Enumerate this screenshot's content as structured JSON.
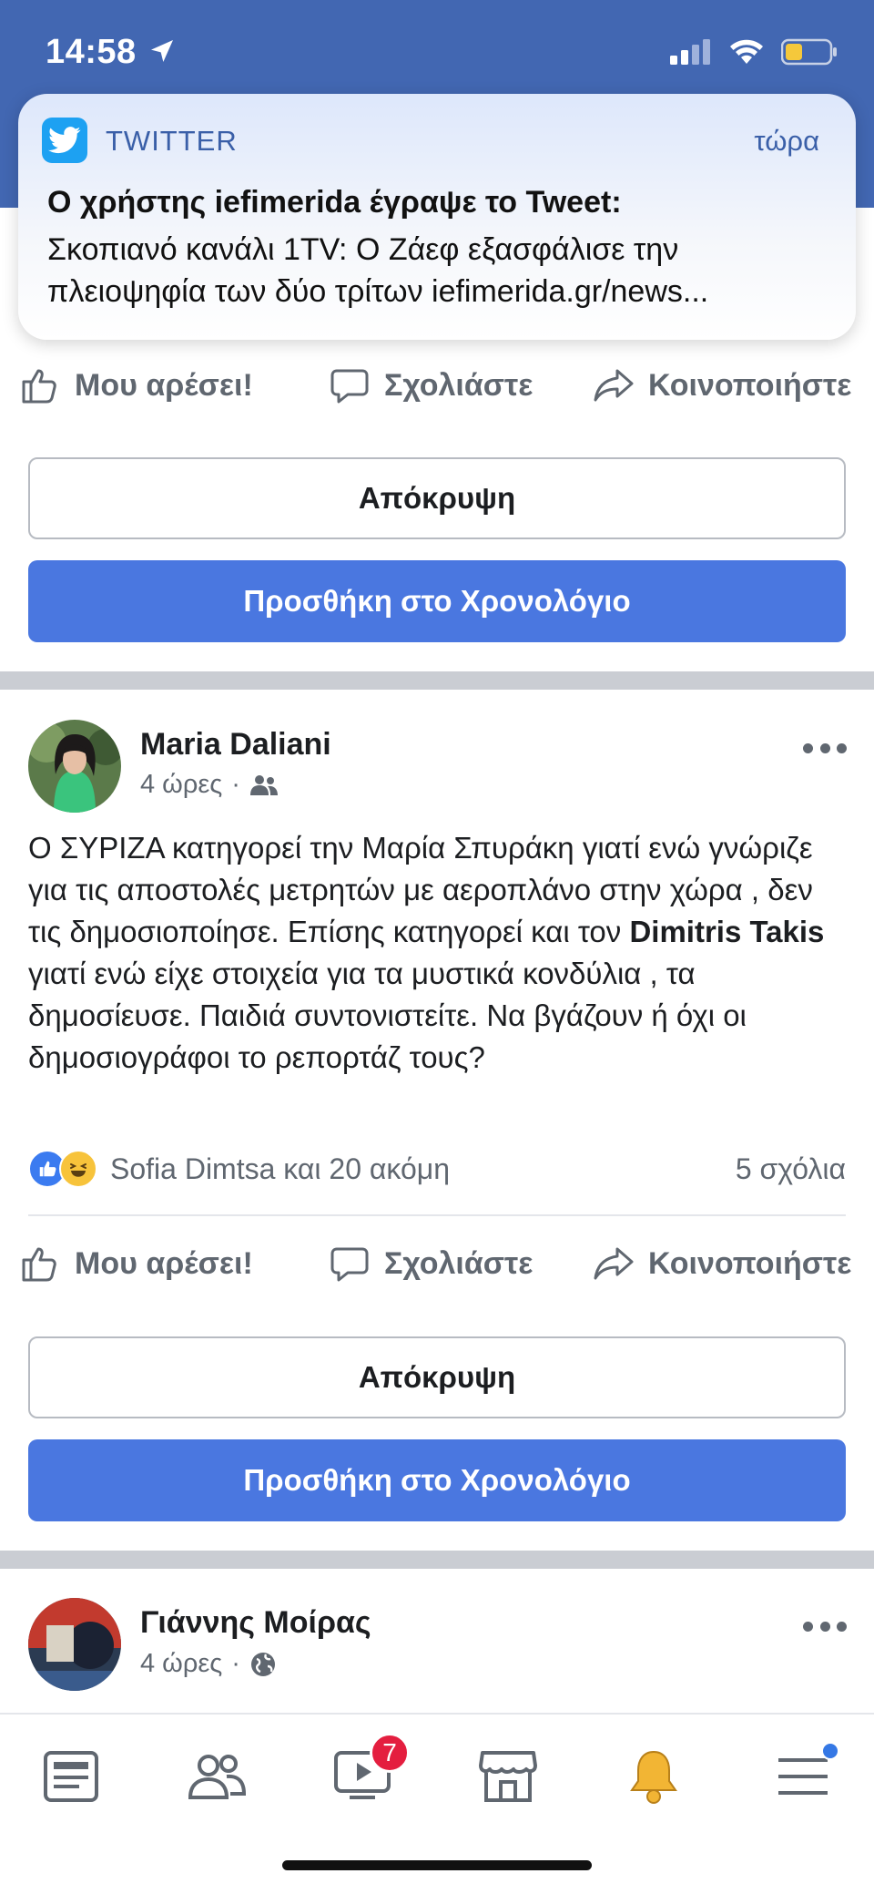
{
  "status_bar": {
    "time": "14:58",
    "icons": [
      "location-arrow-icon",
      "cellular-signal-icon",
      "wifi-icon",
      "battery-icon"
    ]
  },
  "notification": {
    "app_name": "TWITTER",
    "time": "τώρα",
    "title": "Ο χρήστης iefimerida έγραψε το Tweet:",
    "body": "Σκοπιανό κανάλι 1TV: Ο Ζάεφ εξασφάλισε την πλειοψηφία των δύο τρίτων iefimerida.gr/news..."
  },
  "actions": {
    "like": "Μου αρέσει!",
    "comment": "Σχολιάστε",
    "share": "Κοινοποιήστε"
  },
  "suggestion_buttons": {
    "hide": "Απόκρυψη",
    "add": "Προσθήκη στο Χρονολόγιο"
  },
  "posts": [
    {
      "author": "Maria Daliani",
      "time": "4 ώρες",
      "text_before": "Ο ΣΥΡΙΖΑ κατηγορεί την Μαρία Σπυράκη γιατί ενώ γνώριζε για τις αποστολές μετρητών με αεροπλάνο στην χώρα , δεν τις δημοσιοποίησε.  Επίσης κατηγορεί και τον ",
      "mention": "Dimitris Takis",
      "text_after": " γιατί ενώ είχε στοιχεία για τα μυστικά κονδύλια , τα δημοσίευσε. Παιδιά συντονιστείτε. Να βγάζουν ή όχι οι δημοσιογράφοι το ρεπορτάζ τους?",
      "reactions": "Sofia Dimtsa και 20 ακόμη",
      "comments": "5 σχόλια"
    },
    {
      "author": "Γιάννης Μοίρας",
      "time": "4 ώρες"
    }
  ],
  "bottom_nav": {
    "items": [
      "news-feed-icon",
      "friends-icon",
      "watch-icon",
      "marketplace-icon",
      "notifications-bell-icon",
      "menu-icon"
    ],
    "watch_badge": "7"
  },
  "colors": {
    "brand": "#4267b2",
    "primary_button": "#4a77e0",
    "badge": "#e41e3f"
  }
}
